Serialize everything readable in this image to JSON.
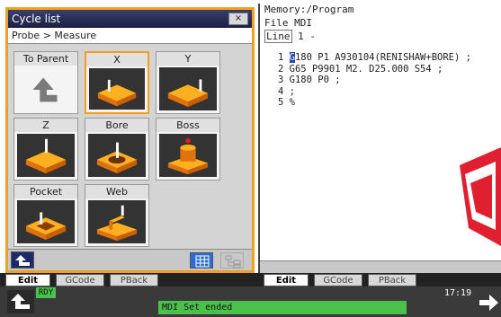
{
  "dialog": {
    "title": "Cycle list",
    "close_label": "×",
    "breadcrumb": "Probe > Measure",
    "cycles": [
      {
        "label": "To Parent",
        "icon": "return-arrow-icon"
      },
      {
        "label": "X",
        "icon": "probe-x-icon",
        "selected": true
      },
      {
        "label": "Y",
        "icon": "probe-y-icon"
      },
      {
        "label": "Z",
        "icon": "probe-z-icon"
      },
      {
        "label": "Bore",
        "icon": "probe-bore-icon"
      },
      {
        "label": "Boss",
        "icon": "probe-boss-icon"
      },
      {
        "label": "Pocket",
        "icon": "probe-pocket-icon"
      },
      {
        "label": "Web",
        "icon": "probe-web-icon"
      }
    ]
  },
  "left_tabs": [
    "Edit",
    "GCode",
    "PBack"
  ],
  "program": {
    "path": "Memory:/Program",
    "file_label": "File",
    "file_value": "MDI",
    "line_label": "Line",
    "line_value": "1 -",
    "lines": [
      {
        "num": "1",
        "cursor_char": "G",
        "rest": "180 P1 A930104(RENISHAW+BORE) ;"
      },
      {
        "num": "2",
        "cursor_char": "",
        "rest": "G65 P9901 M2. D25.000 S54 ;"
      },
      {
        "num": "3",
        "cursor_char": "",
        "rest": "G180 P0 ;"
      },
      {
        "num": "4",
        "cursor_char": "",
        "rest": ";"
      },
      {
        "num": "5",
        "cursor_char": "",
        "rest": "%"
      }
    ]
  },
  "right_tabs": [
    "Edit",
    "GCode",
    "PBack"
  ],
  "status": {
    "ready": "RDY",
    "message": "MDI Set ended",
    "time": "17:19"
  },
  "colors": {
    "accent": "#f0a020",
    "status_green": "#4ac14a",
    "cursor_blue": "#1b44c9",
    "title_navy": "#1c2044"
  }
}
